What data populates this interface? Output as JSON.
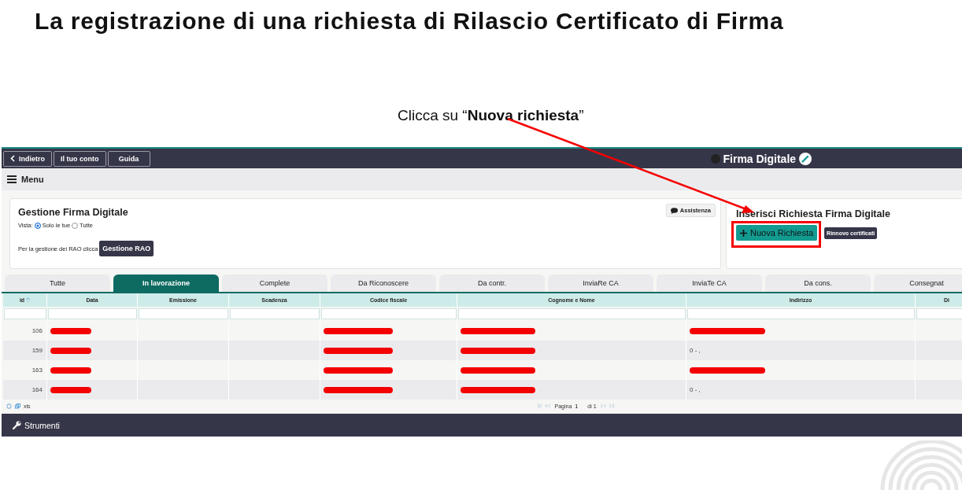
{
  "slide": {
    "title": "La registrazione di una richiesta di Rilascio Certificato di Firma",
    "annotation": "Clicca su “**Nuova richiesta**”"
  },
  "topbar": {
    "buttons": [
      "Indietro",
      "Il tuo conto",
      "Guida"
    ],
    "app_title": "Firma Digitale"
  },
  "menu": {
    "label": "Menu"
  },
  "management": {
    "title": "Gestione Firma Digitale",
    "view_label": "Vista:",
    "view_options": [
      {
        "label": "Solo le tue",
        "selected": true
      },
      {
        "label": "Tutte",
        "selected": false
      }
    ],
    "rao_text": "Per la gestione dei RAO clicca",
    "rao_button": "Gestione RAO",
    "help_button": "Assistenza"
  },
  "insert_panel": {
    "title": "Inserisci Richiesta Firma Digitale",
    "new_button": "Nuova Richiesta",
    "renew_button": "Rinnovo certificati"
  },
  "tabs": [
    {
      "label": "Tutte",
      "selected": false
    },
    {
      "label": "In lavorazione",
      "selected": true
    },
    {
      "label": "Complete",
      "selected": false
    },
    {
      "label": "Da Riconoscere",
      "selected": false
    },
    {
      "label": "Da contr.",
      "selected": false
    },
    {
      "label": "InviaRe CA",
      "selected": false
    },
    {
      "label": "InviaTe CA",
      "selected": false
    },
    {
      "label": "Da cons.",
      "selected": false
    },
    {
      "label": "Consegnat",
      "selected": false
    }
  ],
  "table": {
    "columns": [
      {
        "label": "id",
        "sorted": true
      },
      {
        "label": "Data",
        "sorted": false
      },
      {
        "label": "Emissione",
        "sorted": false
      },
      {
        "label": "Scadenza",
        "sorted": false
      },
      {
        "label": "Codice fiscale",
        "sorted": false
      },
      {
        "label": "Cognome e Nome",
        "sorted": false
      },
      {
        "label": "Indirizzo",
        "sorted": false
      },
      {
        "label": "Di",
        "sorted": false
      }
    ],
    "rows": [
      {
        "cells": [
          {
            "text": "106",
            "redacted": false
          },
          {
            "redacted": true
          },
          {
            "redacted": false
          },
          {
            "redacted": false
          },
          {
            "redacted": true
          },
          {
            "redacted": true
          },
          {
            "redacted": true
          },
          {
            "redacted": false
          }
        ]
      },
      {
        "cells": [
          {
            "text": "159",
            "redacted": false
          },
          {
            "redacted": true
          },
          {
            "redacted": false
          },
          {
            "redacted": false
          },
          {
            "redacted": true
          },
          {
            "redacted": true
          },
          {
            "text": "0 - ,",
            "redacted": false
          },
          {
            "redacted": false
          }
        ]
      },
      {
        "cells": [
          {
            "text": "163",
            "redacted": false
          },
          {
            "redacted": true
          },
          {
            "redacted": false
          },
          {
            "redacted": false
          },
          {
            "redacted": true
          },
          {
            "redacted": true
          },
          {
            "redacted": true
          },
          {
            "redacted": false
          }
        ]
      },
      {
        "cells": [
          {
            "text": "164",
            "redacted": false
          },
          {
            "redacted": true
          },
          {
            "redacted": false
          },
          {
            "redacted": false
          },
          {
            "redacted": true
          },
          {
            "redacted": true
          },
          {
            "text": "0 - ,",
            "redacted": false
          },
          {
            "redacted": false
          }
        ]
      }
    ]
  },
  "footer": {
    "export": "xls",
    "page_label": "Pagina",
    "page": "1",
    "page_total": "di 1"
  },
  "tools_bar": {
    "label": "Strumenti"
  }
}
